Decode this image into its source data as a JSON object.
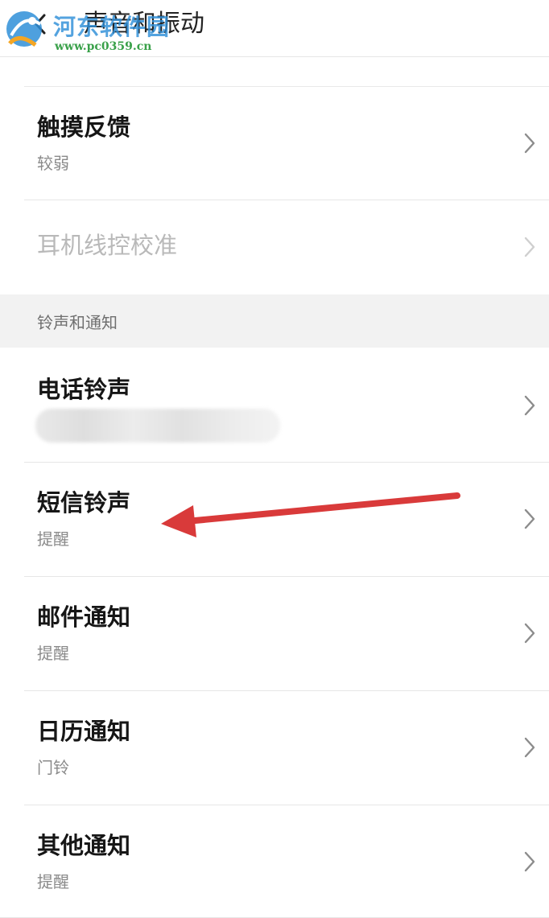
{
  "header": {
    "title": "声音和振动",
    "back_icon": "chevron-left-icon"
  },
  "watermark": {
    "site_name": "河东软件园",
    "url": "www.pc0359.cn",
    "colors": {
      "name": "#2f8fd8",
      "url": "#3aa14a"
    }
  },
  "feedback_items": [
    {
      "title": "触摸反馈",
      "subtitle": "较弱",
      "enabled": true
    },
    {
      "title": "耳机线控校准",
      "subtitle": "",
      "enabled": false
    }
  ],
  "ringtone_section": {
    "label": "铃声和通知",
    "items": [
      {
        "title": "电话铃声",
        "subtitle": "",
        "subtitle_blurred": true
      },
      {
        "title": "短信铃声",
        "subtitle": "提醒"
      },
      {
        "title": "邮件通知",
        "subtitle": "提醒"
      },
      {
        "title": "日历通知",
        "subtitle": "门铃"
      },
      {
        "title": "其他通知",
        "subtitle": "提醒"
      }
    ]
  },
  "annotation": {
    "type": "arrow",
    "color": "#d93a3a",
    "points_to": "短信铃声"
  },
  "icons": {
    "row_chevron": "chevron-right-icon"
  }
}
